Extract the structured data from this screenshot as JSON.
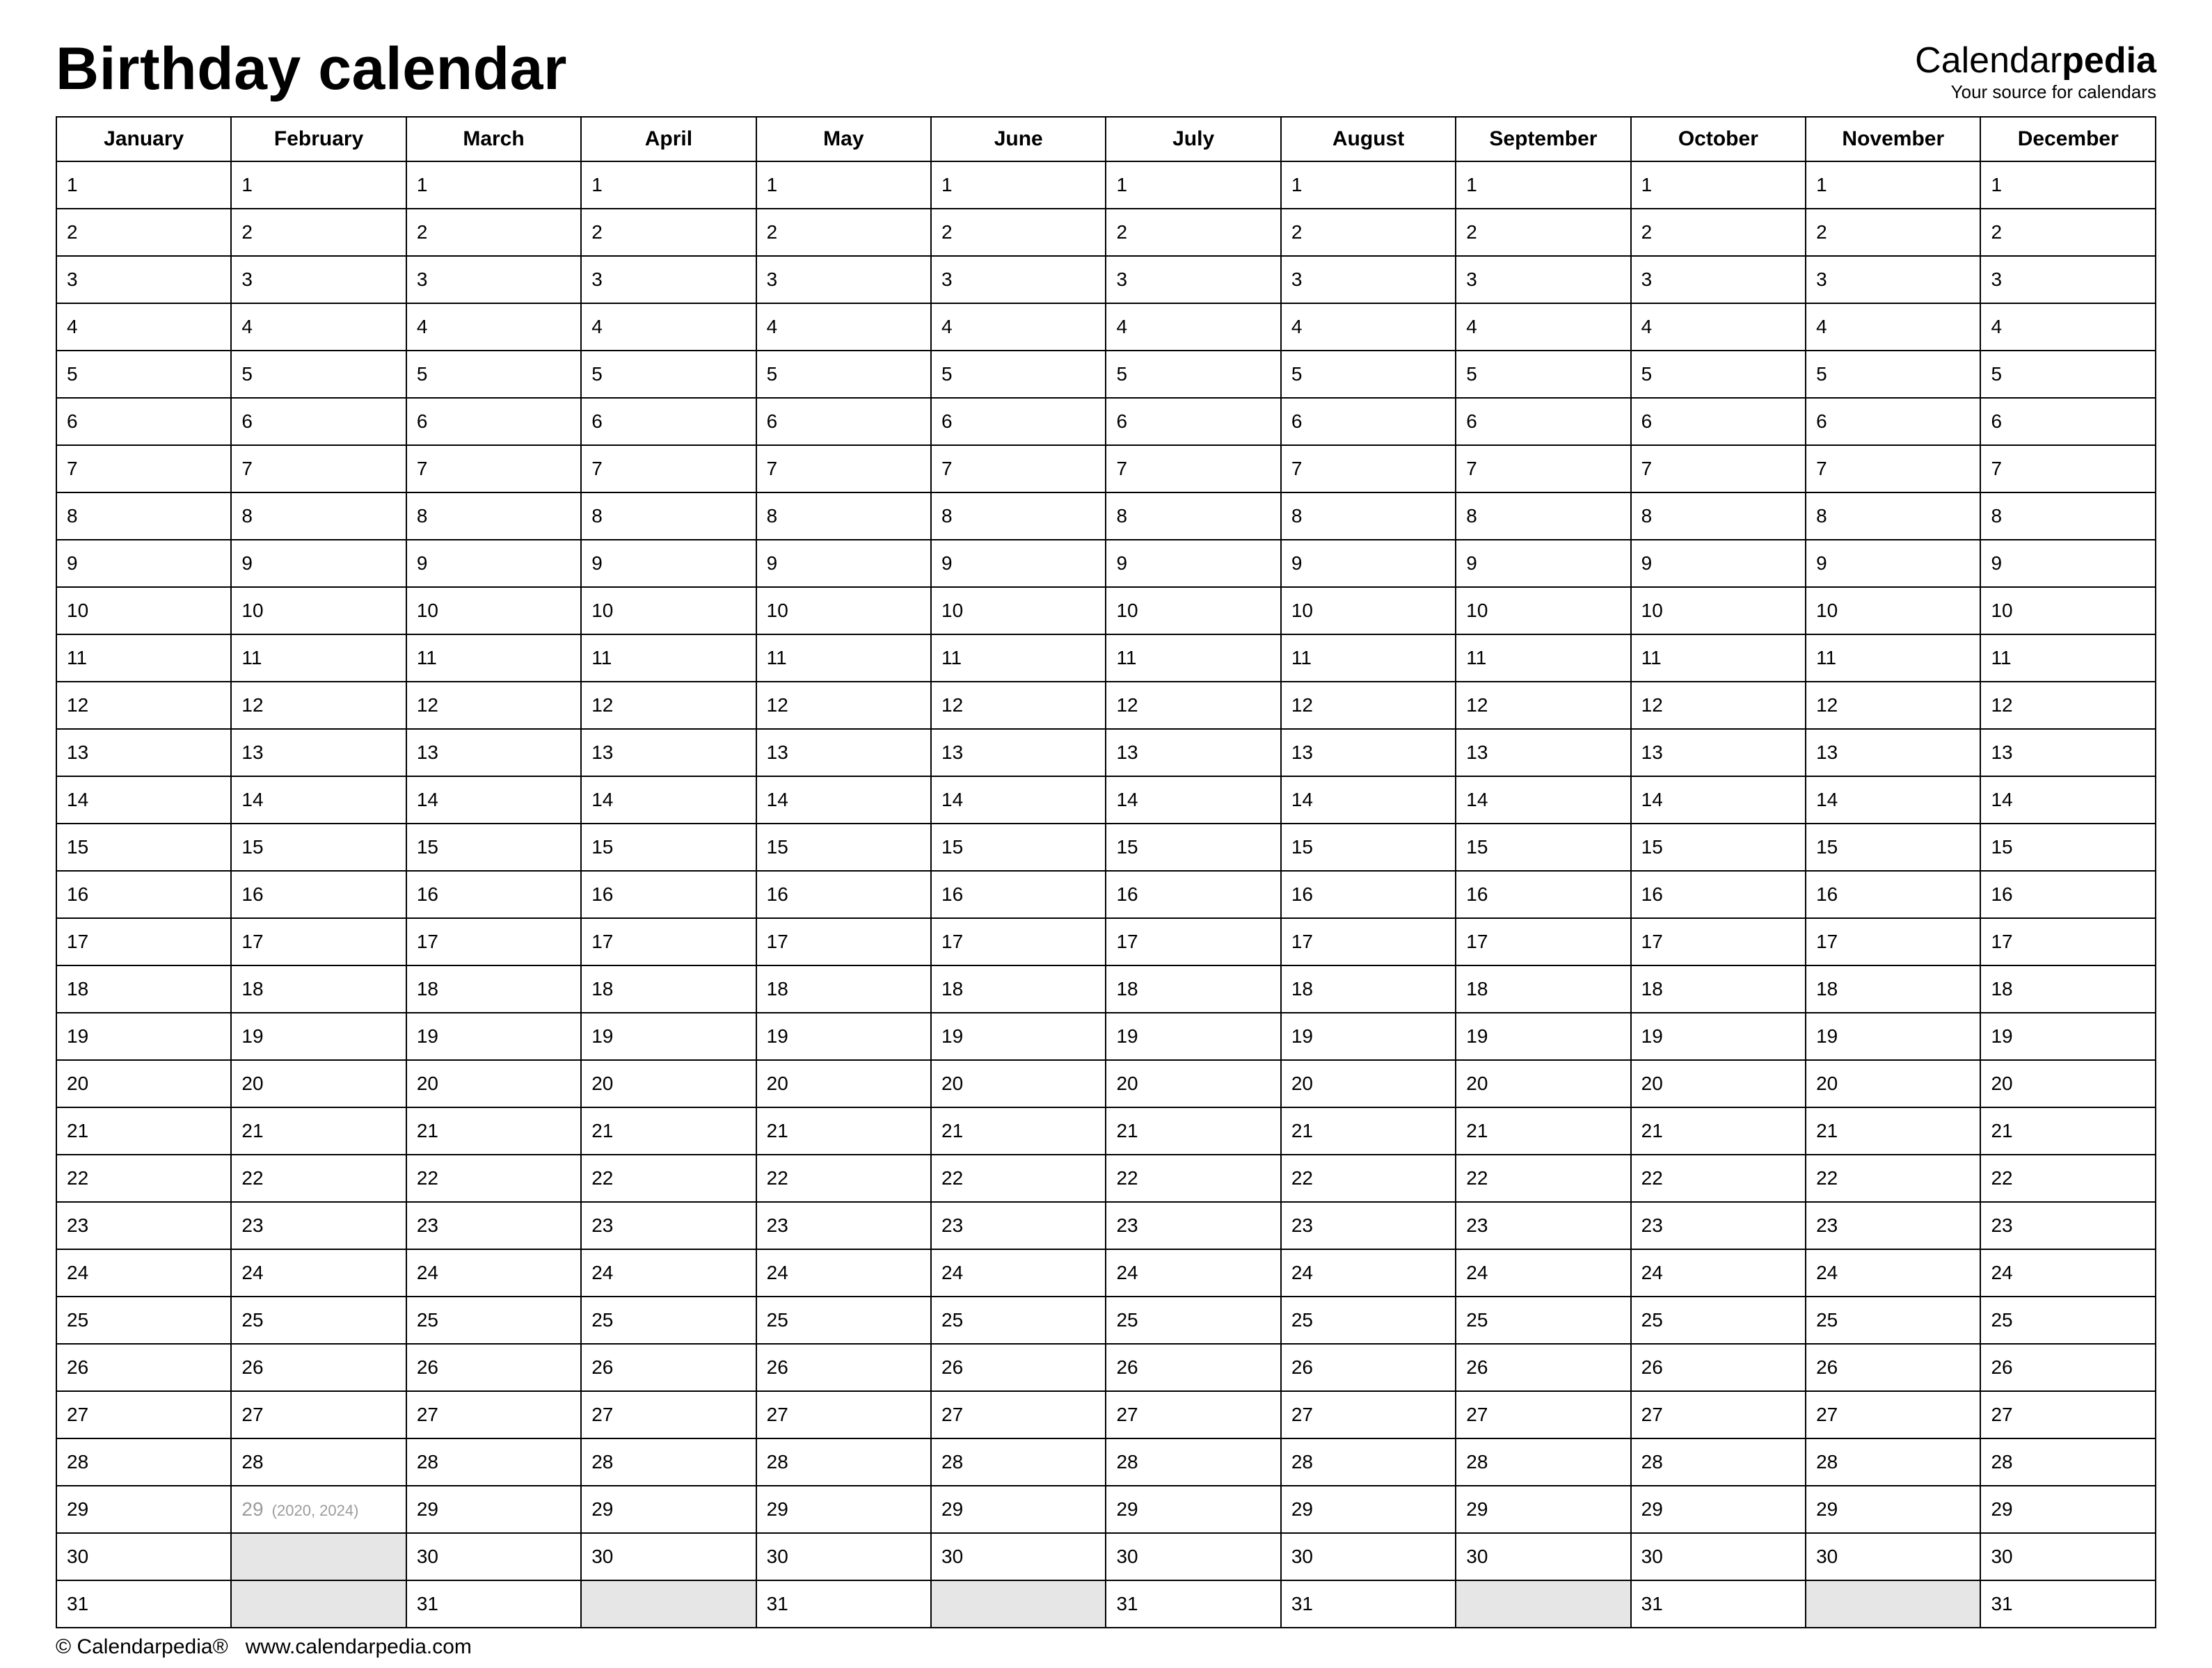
{
  "header": {
    "title": "Birthday calendar",
    "brand_a": "Calendar",
    "brand_b": "pedia",
    "brand_tag": "Your source for calendars"
  },
  "months": [
    "January",
    "February",
    "March",
    "April",
    "May",
    "June",
    "July",
    "August",
    "September",
    "October",
    "November",
    "December"
  ],
  "month_days": [
    31,
    29,
    31,
    30,
    31,
    30,
    31,
    31,
    30,
    31,
    30,
    31
  ],
  "leap_note": "(2020, 2024)",
  "footer": {
    "copyright": "© Calendarpedia®",
    "url": "www.calendarpedia.com"
  }
}
